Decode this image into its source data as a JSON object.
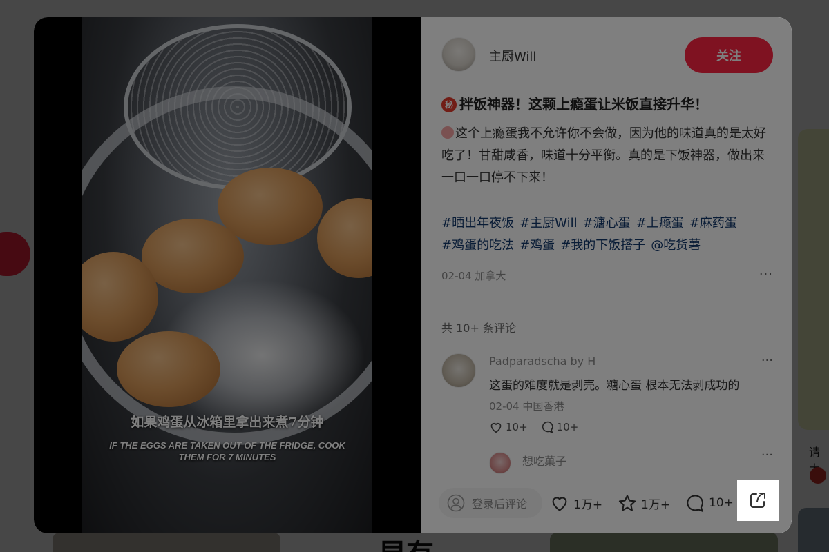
{
  "background": {
    "right_card_text": "请大",
    "bottom_text": "早有"
  },
  "media": {
    "subtitle_zh": "如果鸡蛋从冰箱里拿出来煮7分钟",
    "subtitle_en": "IF THE EGGS ARE TAKEN OUT OF THE FRIDGE, COOK THEM FOR 7 MINUTES"
  },
  "author": {
    "name": "主厨Will",
    "follow_label": "关注"
  },
  "note": {
    "title_badge": "秘",
    "title": "拌饭神器！这颗上瘾蛋让米饭直接升华！",
    "description": "这个上瘾蛋我不允许你不会做，因为他的味道真的是太好吃了！甘甜咸香，味道十分平衡。真的是下饭神器，做出来一口一口停不下来！",
    "tags": [
      "#晒出年夜饭",
      "#主厨Will",
      "#溏心蛋",
      "#上瘾蛋",
      "#麻药蛋",
      "#鸡蛋的吃法",
      "#鸡蛋",
      "#我的下饭搭子",
      "@吃货薯"
    ],
    "date_location": "02-04 加拿大",
    "more": "···"
  },
  "comments": {
    "count_label": "共 10+ 条评论",
    "items": [
      {
        "user": "Padparadscha by H",
        "text": "这蛋的难度就是剥壳。糖心蛋 根本无法剥成功的",
        "meta": "02-04 中国香港",
        "likes": "10+",
        "replies": "10+",
        "more": "···"
      },
      {
        "user": "想吃菓子",
        "more": "···"
      }
    ]
  },
  "bottom_bar": {
    "comment_placeholder": "登录后评论",
    "likes": "1万+",
    "collects": "1万+",
    "comments": "10+"
  },
  "colors": {
    "accent": "#ff2442",
    "tag": "#13386c"
  }
}
